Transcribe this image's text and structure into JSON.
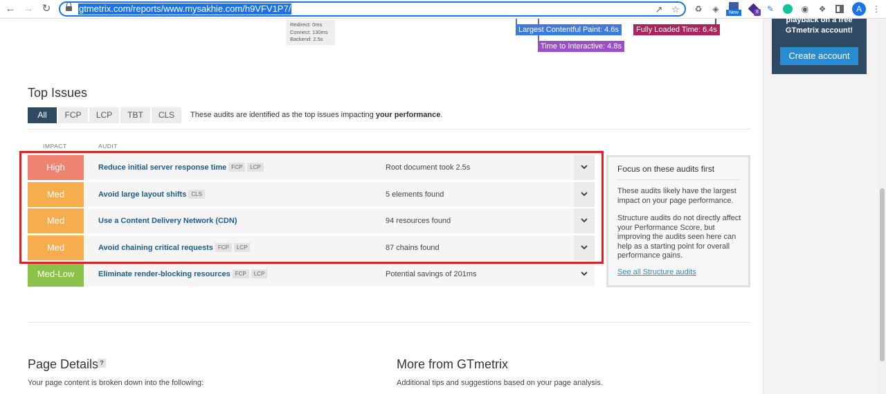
{
  "browser": {
    "url": "gtmetrix.com/reports/www.mysakhie.com/h9VFV1P7/",
    "avatar_letter": "A",
    "ext_badge": "8",
    "ext_new": "New"
  },
  "waterfall": {
    "timing_lines": [
      "Redirect: 0ms",
      "Connect: 130ms",
      "Backend: 2.5s"
    ],
    "lcp_label": "Largest Contentful Paint: 4.6s",
    "flt_label": "Fully Loaded Time: 6.4s",
    "tti_label": "Time to Interactive: 4.8s"
  },
  "promo": {
    "text_line1": "playback on a free",
    "text_line2": "GTmetrix account!",
    "button": "Create account"
  },
  "top_issues": {
    "title": "Top Issues",
    "filters": [
      "All",
      "FCP",
      "LCP",
      "TBT",
      "CLS"
    ],
    "active_filter": "All",
    "desc_prefix": "These audits are identified as the top issues impacting ",
    "desc_bold": "your performance",
    "desc_suffix": ".",
    "col_impact": "IMPACT",
    "col_audit": "AUDIT",
    "rows": [
      {
        "impact": "High",
        "audit": "Reduce initial server response time",
        "chips": [
          "FCP",
          "LCP"
        ],
        "result": "Root document took 2.5s"
      },
      {
        "impact": "Med",
        "audit": "Avoid large layout shifts",
        "chips": [
          "CLS"
        ],
        "result": "5 elements found"
      },
      {
        "impact": "Med",
        "audit": "Use a Content Delivery Network (CDN)",
        "chips": [],
        "result": "94 resources found"
      },
      {
        "impact": "Med",
        "audit": "Avoid chaining critical requests",
        "chips": [
          "FCP",
          "LCP"
        ],
        "result": "87 chains found"
      },
      {
        "impact": "Med-Low",
        "audit": "Eliminate render-blocking resources",
        "chips": [
          "FCP",
          "LCP"
        ],
        "result": "Potential savings of 201ms"
      }
    ]
  },
  "focus": {
    "title": "Focus on these audits first",
    "p1": "These audits likely have the largest impact on your page performance.",
    "p2": "Structure audits do not directly affect your Performance Score, but improving the audits seen here can help as a starting point for overall performance gains.",
    "link": "See all Structure audits"
  },
  "page_details": {
    "title": "Page Details",
    "help": "?",
    "text": "Your page content is broken down into the following:"
  },
  "more": {
    "title": "More from GTmetrix",
    "text": "Additional tips and suggestions based on your page analysis."
  },
  "colors": {
    "high": "#f08272",
    "med": "#f5ad4e",
    "medlow": "#8bc34a",
    "highlight": "#e02020",
    "accent": "#2f4a62"
  }
}
